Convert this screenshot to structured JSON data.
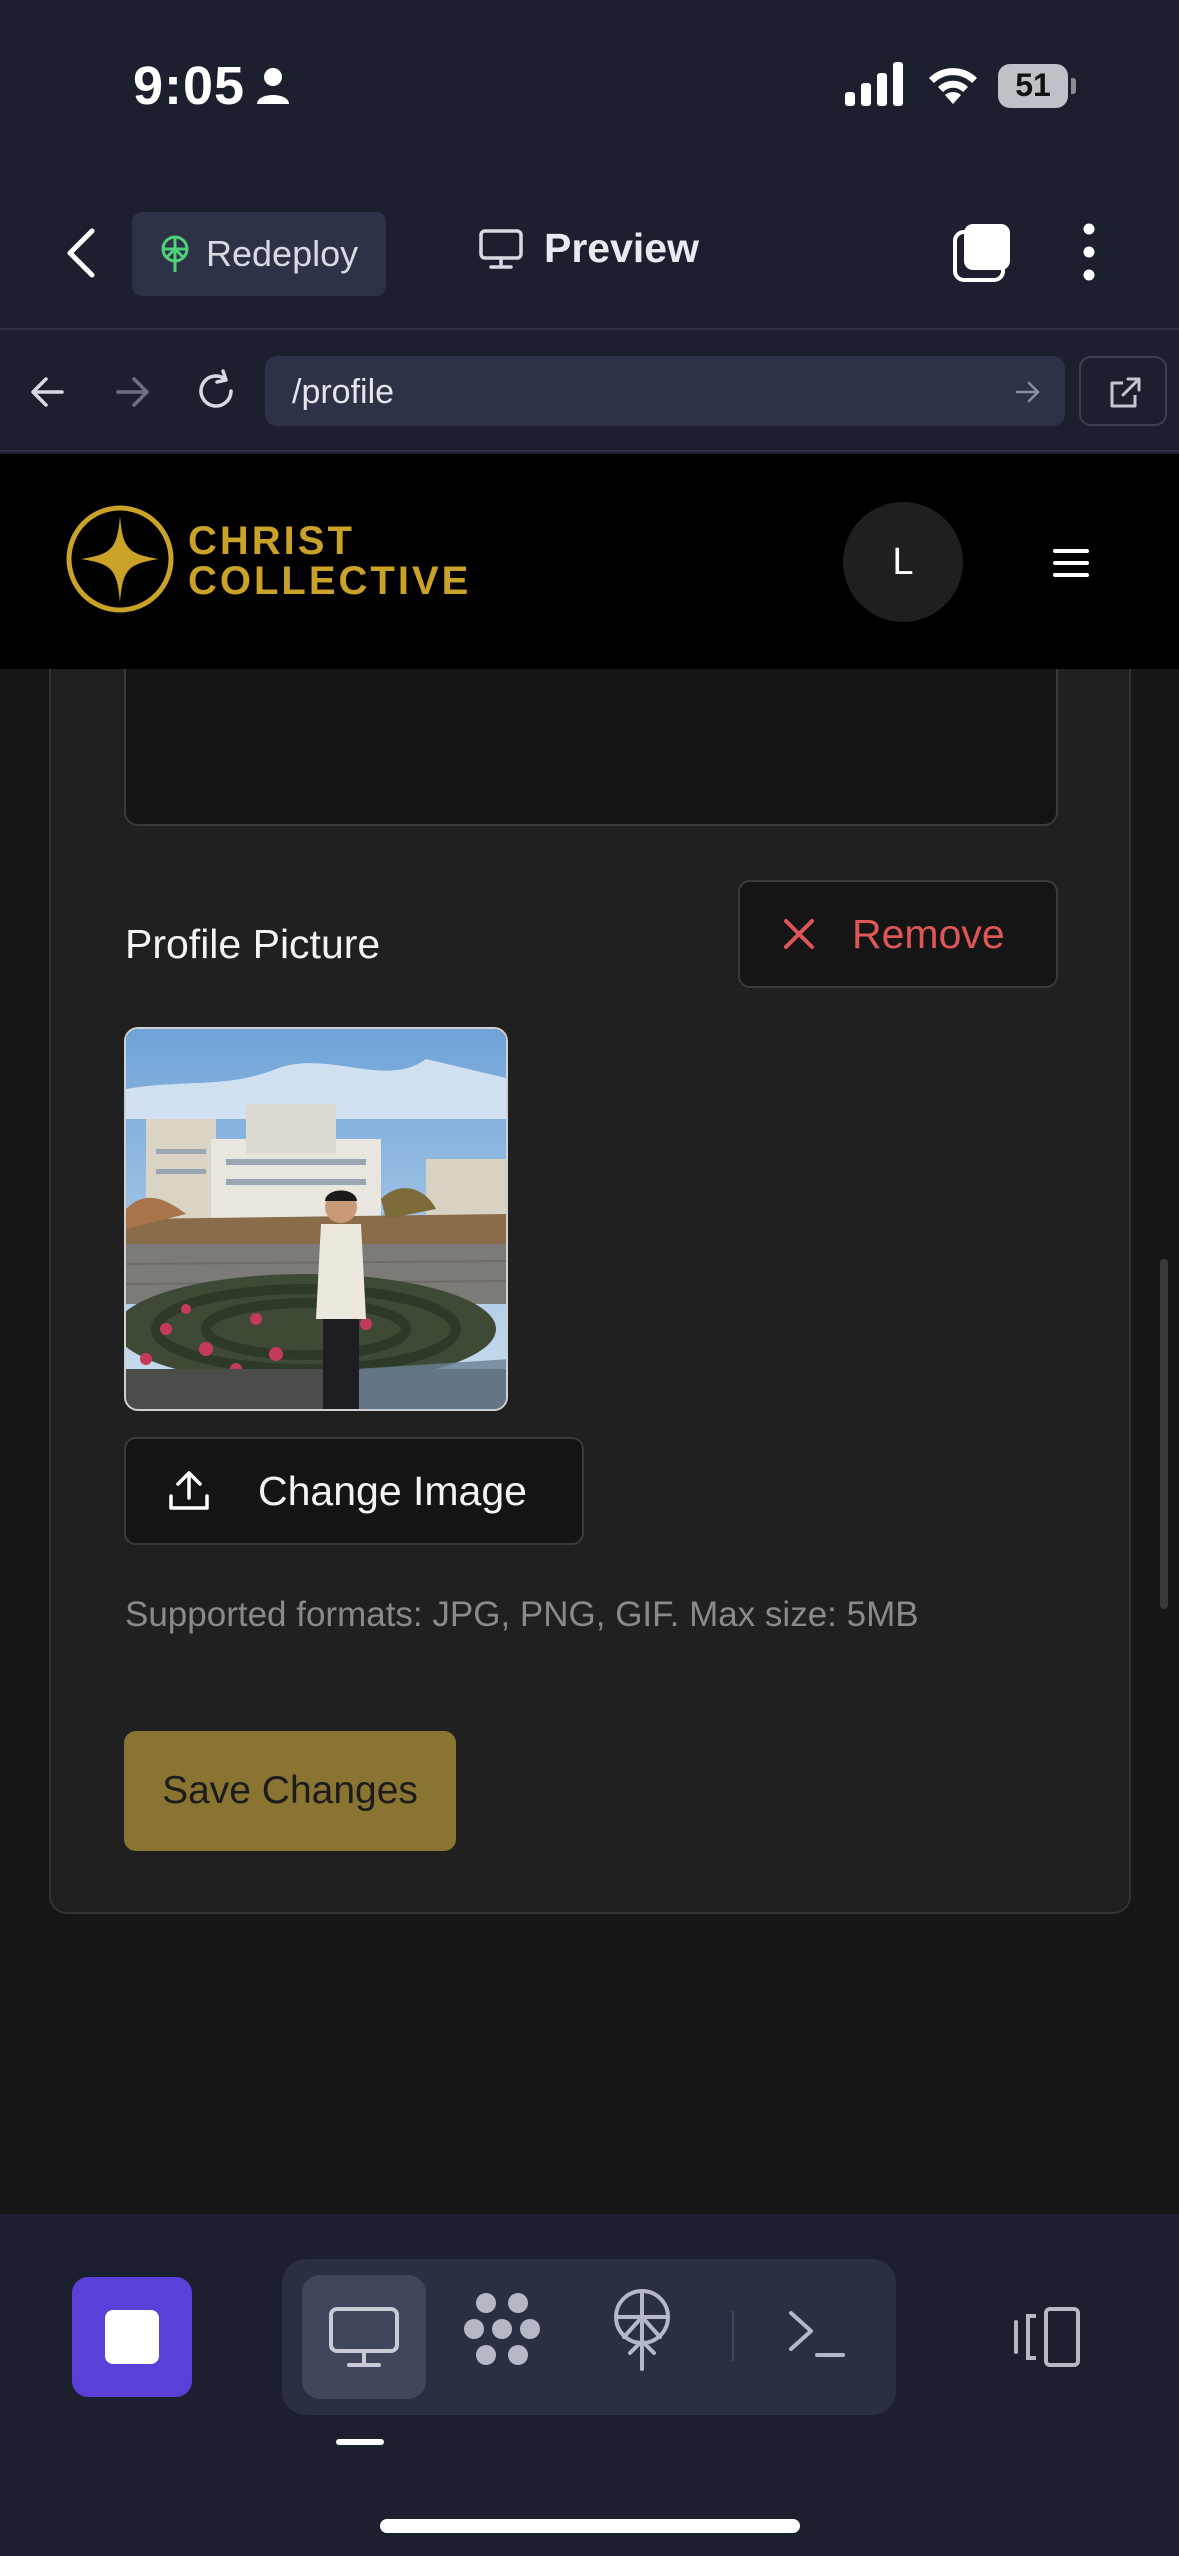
{
  "status_bar": {
    "time": "9:05",
    "battery": "51"
  },
  "app_toolbar": {
    "redeploy_label": "Redeploy",
    "preview_label": "Preview"
  },
  "browser": {
    "url": "/profile"
  },
  "site": {
    "brand_line1": "CHRIST",
    "brand_line2": "COLLECTIVE",
    "avatar_initial": "L",
    "brand_color": "#c9a227"
  },
  "profile_form": {
    "picture_label": "Profile Picture",
    "remove_label": "Remove",
    "change_image_label": "Change Image",
    "supported_formats": "Supported formats: JPG, PNG, GIF. Max size: 5MB",
    "save_label": "Save Changes"
  },
  "bottom_bar": {
    "tools": [
      "desktop-icon",
      "packages-icon",
      "deploy-icon",
      "shell-icon"
    ],
    "active_tool": "desktop-icon",
    "accent_color": "#5b3fd9"
  }
}
